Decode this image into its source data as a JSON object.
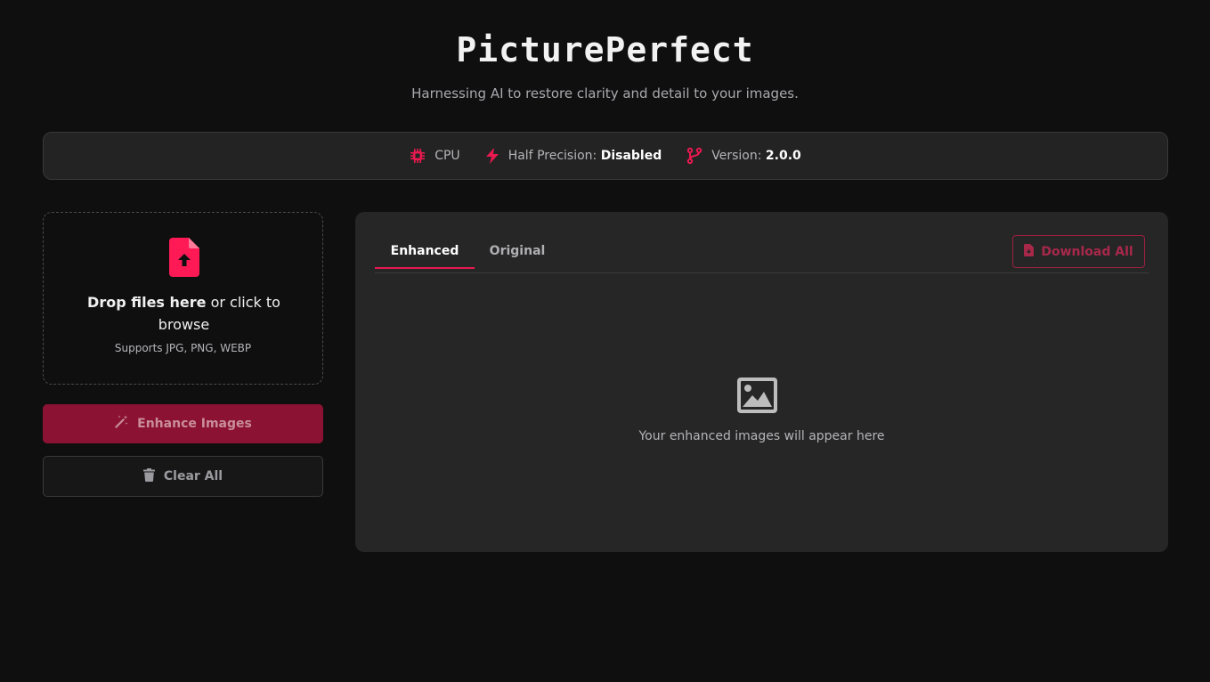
{
  "header": {
    "title": "PicturePerfect",
    "subtitle": "Harnessing AI to restore clarity and detail to your images."
  },
  "status": {
    "device_label": "CPU",
    "precision_label": "Half Precision:",
    "precision_value": "Disabled",
    "version_label": "Version:",
    "version_value": "2.0.0"
  },
  "upload": {
    "drop_bold": "Drop files here",
    "drop_rest": " or click to browse",
    "formats": "Supports JPG, PNG, WEBP"
  },
  "actions": {
    "enhance_label": "Enhance Images",
    "clear_label": "Clear All"
  },
  "results": {
    "tabs": [
      {
        "label": "Enhanced",
        "active": true
      },
      {
        "label": "Original",
        "active": false
      }
    ],
    "download_label": "Download All",
    "empty_text": "Your enhanced images will appear here"
  },
  "colors": {
    "accent": "#e8194f",
    "background": "#0f0f10",
    "panel": "#262627",
    "enhance_button": "#8b1232"
  },
  "icons": [
    "cpu-icon",
    "bolt-icon",
    "code-branch-icon",
    "file-upload-icon",
    "magic-wand-icon",
    "trash-icon",
    "file-download-icon",
    "image-icon"
  ]
}
